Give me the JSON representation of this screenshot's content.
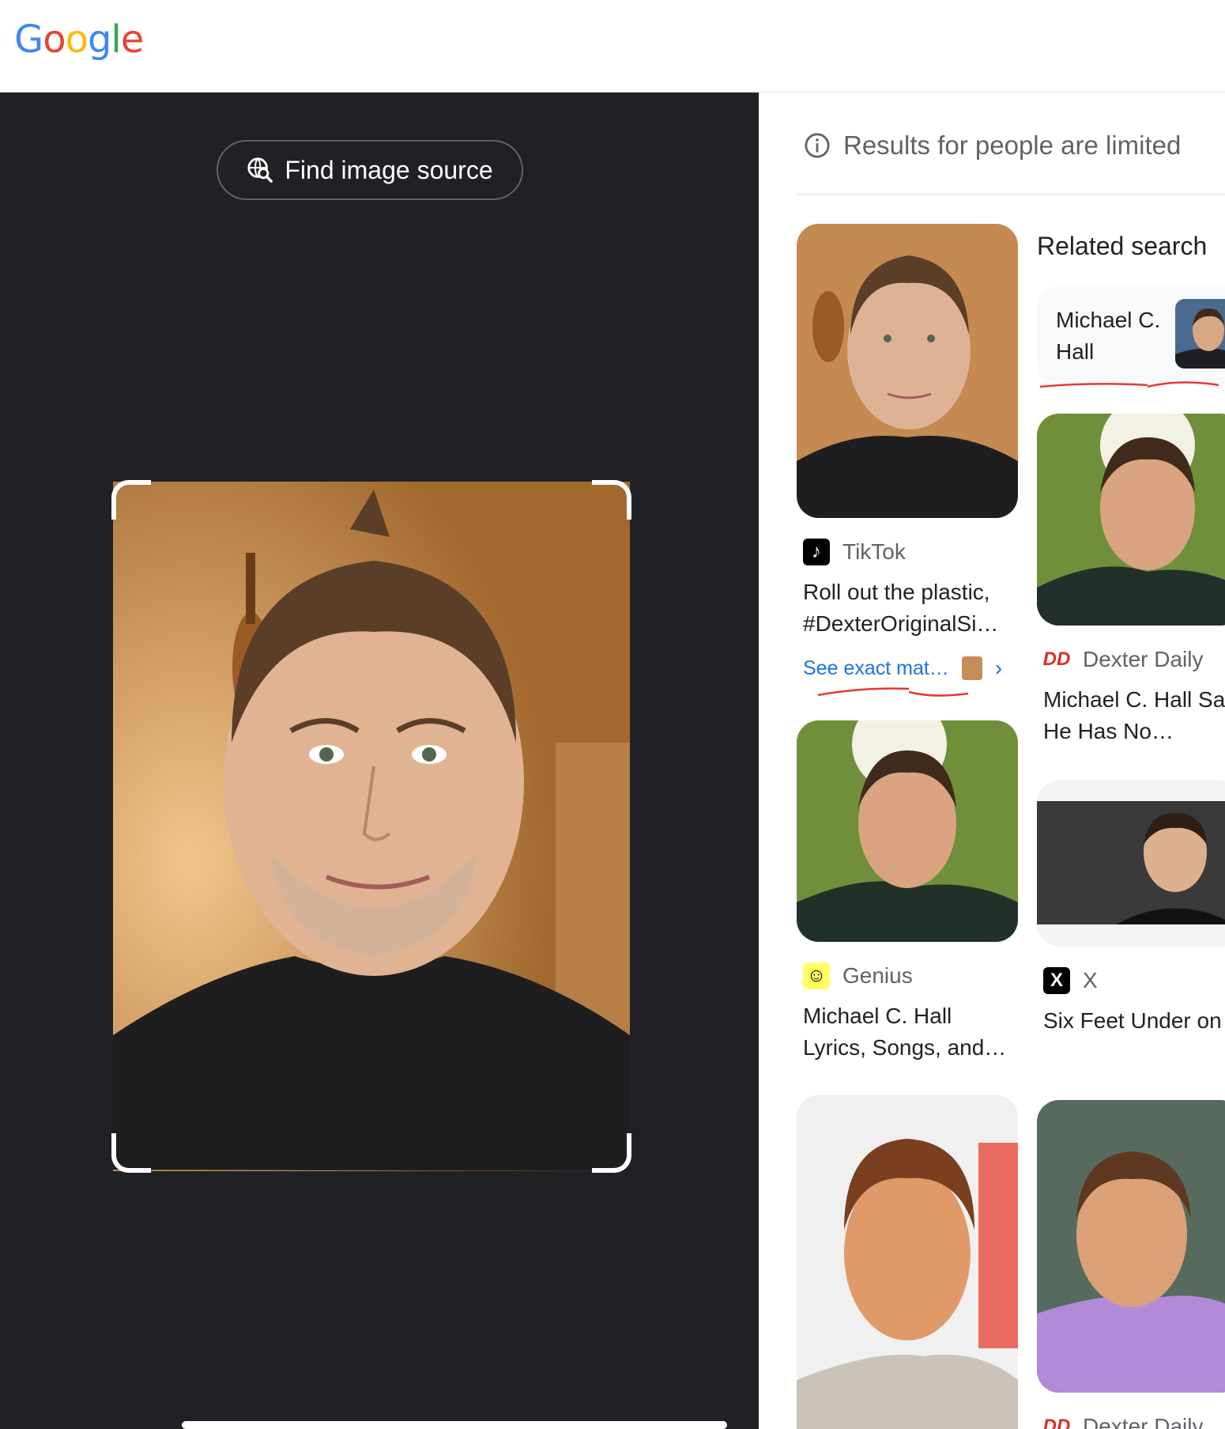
{
  "logo": {
    "letters": [
      "G",
      "o",
      "o",
      "g",
      "l",
      "e"
    ],
    "colors": [
      "#4285F4",
      "#EA4335",
      "#FBBC05",
      "#4285F4",
      "#34A853",
      "#EA4335"
    ]
  },
  "lens": {
    "find_source_label": "Find image source"
  },
  "notice": {
    "text": "Results for people are limited",
    "icon": "info-icon"
  },
  "related": {
    "heading": "Related search",
    "chip_label": "Michael C. Hall"
  },
  "cards": [
    {
      "source": "TikTok",
      "title": "Roll out the plastic, #DexterOriginalSi…",
      "see_exact": "See exact mat…",
      "icon": "tiktok-icon"
    },
    {
      "source": "Dexter Daily",
      "title": "Michael C. Hall Says He Has No…",
      "icon": "dexter-daily-icon"
    },
    {
      "source": "Genius",
      "title": "Michael C. Hall Lyrics, Songs, and…",
      "icon": "genius-icon"
    },
    {
      "source": "X",
      "title": "Six Feet Under on X: \"Michael C Hall",
      "icon": "x-icon"
    },
    {
      "source": "Dexter Daily",
      "icon": "dexter-daily-icon"
    }
  ],
  "colors": {
    "lens_bg": "#202124",
    "link": "#1a73e8",
    "annotation": "#e53935"
  }
}
